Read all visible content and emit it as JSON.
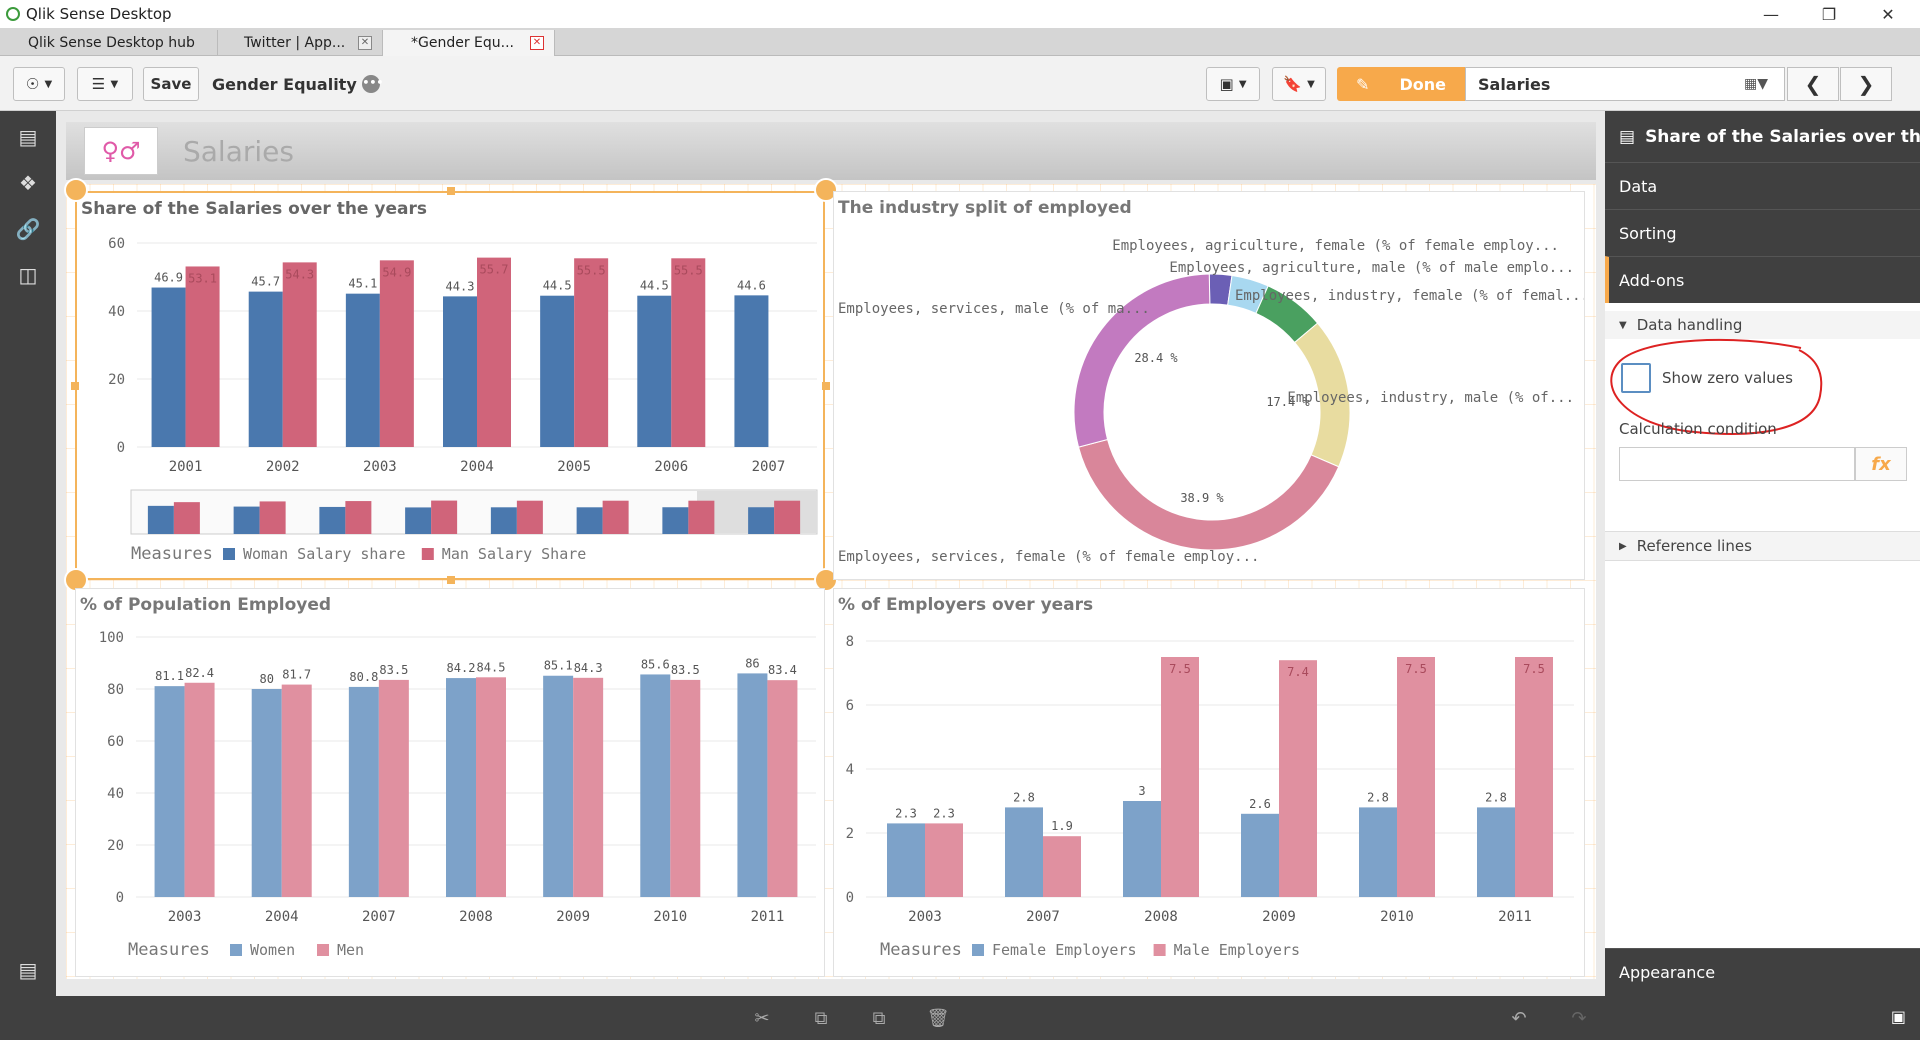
{
  "window": {
    "title": "Qlik Sense Desktop"
  },
  "tabs": [
    {
      "label": "Qlik Sense Desktop hub"
    },
    {
      "label": "Twitter | App..."
    },
    {
      "label": "*Gender Equ..."
    }
  ],
  "toolbar": {
    "save_label": "Save",
    "app_name": "Gender Equality",
    "done_label": "Done",
    "sheet_selector": "Salaries"
  },
  "sheet": {
    "title": "Salaries"
  },
  "panel": {
    "title": "Share of the Salaries over the y...",
    "sections": {
      "data": "Data",
      "sorting": "Sorting",
      "addons": "Add-ons",
      "appearance": "Appearance"
    },
    "data_handling": "Data handling",
    "show_zero": "Show zero values",
    "calc_condition": "Calculation condition",
    "fx": "fx",
    "reference_lines": "Reference lines"
  },
  "colors": {
    "blue": "#4a78ae",
    "red": "#d0647a",
    "blue_light": "#7da2c9",
    "pink": "#e090a0",
    "accent": "#f7a94b",
    "dark": "#404040"
  },
  "chart_data": [
    {
      "type": "bar",
      "title": "Share of the Salaries over the years",
      "categories": [
        "2001",
        "2002",
        "2003",
        "2004",
        "2005",
        "2006",
        "2007"
      ],
      "series": [
        {
          "name": "Woman Salary share",
          "values": [
            46.9,
            45.7,
            45.1,
            44.3,
            44.5,
            44.5,
            44.6
          ]
        },
        {
          "name": "Man Salary Share",
          "values": [
            53.1,
            54.3,
            54.9,
            55.7,
            55.5,
            55.5
          ]
        }
      ],
      "ylim": [
        0,
        60
      ],
      "yticks": [
        0,
        20,
        40,
        60
      ],
      "legend_title": "Measures",
      "legend": "bottom"
    },
    {
      "type": "pie",
      "title": "The industry split of employed",
      "labels": [
        "Employees, agriculture, female (% of female employ...",
        "Employees, agriculture, male (% of male emplo...",
        "Employees, industry, female (% of femal...",
        "Employees, industry, male (% of...",
        "Employees, services, female (% of female employ...",
        "Employees, services, male (% of ma..."
      ],
      "values": [
        2.6,
        4.3,
        7.1,
        17.4,
        38.9,
        28.4
      ],
      "shown_labels": [
        "28.4 %",
        "17.4 %",
        "38.9 %"
      ],
      "colors": [
        "#6b5fb5",
        "#a8d8f0",
        "#4aa060",
        "#e8dca0",
        "#d9869a",
        "#c27ac0"
      ]
    },
    {
      "type": "bar",
      "title": "% of Population Employed",
      "categories": [
        "2003",
        "2004",
        "2007",
        "2008",
        "2009",
        "2010",
        "2011"
      ],
      "series": [
        {
          "name": "Women",
          "values": [
            81.1,
            80,
            80.8,
            84.2,
            85.1,
            85.6,
            86
          ]
        },
        {
          "name": "Men",
          "values": [
            82.4,
            81.7,
            83.5,
            84.5,
            84.3,
            83.5,
            83.4
          ]
        }
      ],
      "ylim": [
        0,
        100
      ],
      "yticks": [
        0,
        20,
        40,
        60,
        80,
        100
      ],
      "legend_title": "Measures",
      "legend": "bottom"
    },
    {
      "type": "bar",
      "title": "% of Employers over years",
      "categories": [
        "2003",
        "2007",
        "2008",
        "2009",
        "2010",
        "2011"
      ],
      "series": [
        {
          "name": "Female Employers",
          "values": [
            2.3,
            2.8,
            3,
            2.6,
            2.8,
            2.8
          ]
        },
        {
          "name": "Male Employers",
          "values": [
            2.3,
            1.9,
            7.5,
            7.4,
            7.5,
            7.5
          ]
        }
      ],
      "ylim": [
        0,
        8
      ],
      "yticks": [
        0,
        2,
        4,
        6,
        8
      ],
      "legend_title": "Measures",
      "legend": "bottom"
    }
  ]
}
